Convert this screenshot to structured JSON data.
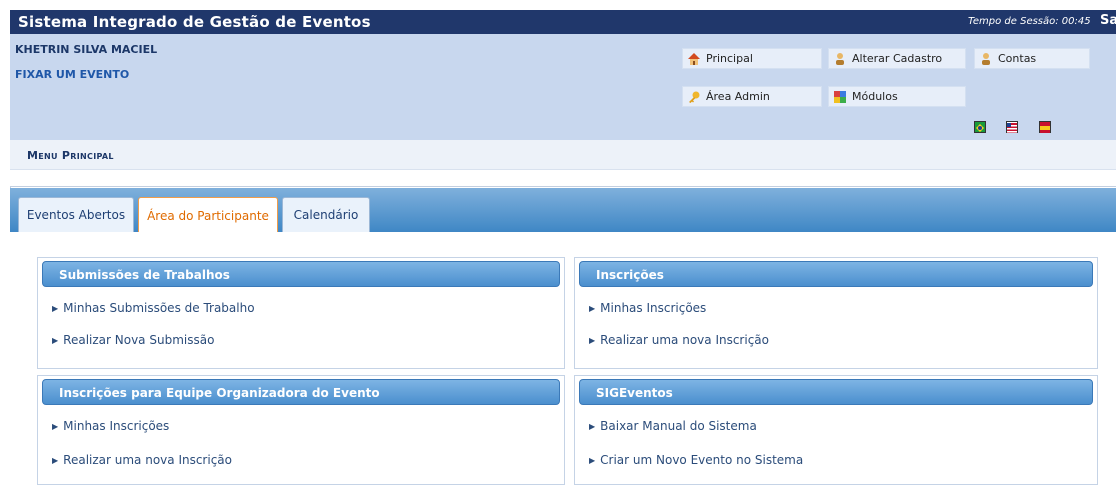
{
  "header": {
    "title": "Sistema Integrado de Gestão de Eventos",
    "session_label": "Tempo de Sessão: 00:45",
    "exit_label": "Sair"
  },
  "user": {
    "name": "KHETRIN SILVA MACIEL",
    "fix_event": "FIXAR UM EVENTO"
  },
  "quick_buttons": {
    "principal": "Principal",
    "alterar_cadastro": "Alterar Cadastro",
    "contas": "Contas",
    "area_admin": "Área Admin",
    "modulos": "Módulos"
  },
  "menu": {
    "label": "Menu Principal"
  },
  "tabs": [
    {
      "label": "Eventos Abertos"
    },
    {
      "label": "Área do Participante"
    },
    {
      "label": "Calendário"
    }
  ],
  "panels": {
    "submissoes": {
      "title": "Submissões de Trabalhos",
      "links": [
        "Minhas Submissões de Trabalho",
        "Realizar Nova Submissão"
      ]
    },
    "inscricoes": {
      "title": "Inscrições",
      "links": [
        "Minhas Inscrições",
        "Realizar uma nova Inscrição"
      ]
    },
    "equipe": {
      "title": "Inscrições para Equipe Organizadora do Evento",
      "links": [
        "Minhas Inscrições",
        "Realizar uma nova Inscrição"
      ]
    },
    "sigeventos": {
      "title": "SIGEventos",
      "links": [
        "Baixar Manual do Sistema",
        "Criar um Novo Evento no Sistema"
      ]
    }
  },
  "colors": {
    "header_bg": "#20376b",
    "info_bg": "#c8d7ee",
    "tab_active": "#e06b00",
    "panel_head": "#4b8fce"
  }
}
